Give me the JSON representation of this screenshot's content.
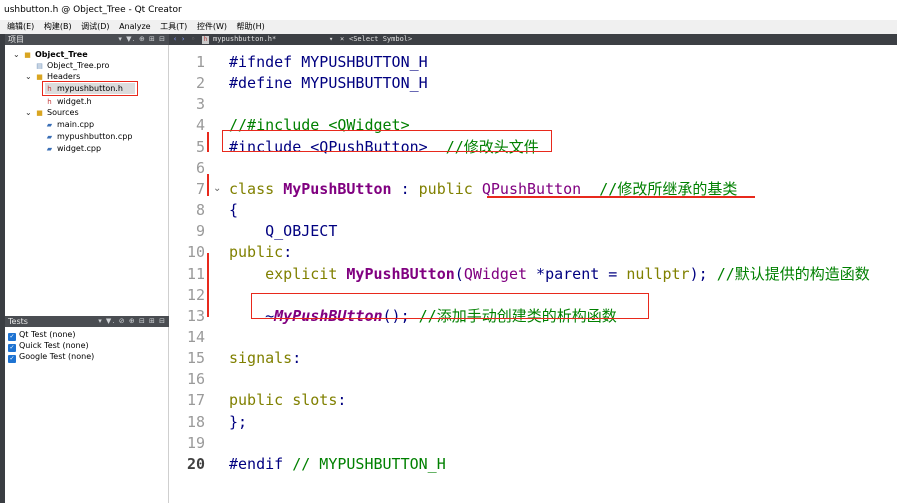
{
  "window": {
    "title": "ushbutton.h @ Object_Tree - Qt Creator"
  },
  "menu": [
    "编辑(E)",
    "构建(B)",
    "调试(D)",
    "Analyze",
    "工具(T)",
    "控件(W)",
    "帮助(H)"
  ],
  "projects_panel": {
    "title": "项目",
    "tools": "▾ ▼. ⊕ ⊞ ⊟",
    "tree": [
      {
        "label": "Object_Tree",
        "icon": "folder-icon",
        "bold": true
      },
      {
        "label": "Object_Tree.pro",
        "icon": "pro-file-icon"
      },
      {
        "label": "Headers",
        "icon": "folder-icon"
      },
      {
        "label": "mypushbutton.h",
        "icon": "header-file-icon",
        "selected": true
      },
      {
        "label": "widget.h",
        "icon": "header-file-icon"
      },
      {
        "label": "Sources",
        "icon": "folder-icon"
      },
      {
        "label": "main.cpp",
        "icon": "cpp-file-icon"
      },
      {
        "label": "mypushbutton.cpp",
        "icon": "cpp-file-icon"
      },
      {
        "label": "widget.cpp",
        "icon": "cpp-file-icon"
      }
    ]
  },
  "tests_panel": {
    "title": "Tests",
    "tools": "▾ ▼. ⊘ ⊕ ⊟ ⊞ ⊟",
    "items": [
      {
        "label": "Qt Test (none)",
        "checked": true
      },
      {
        "label": "Quick Test (none)",
        "checked": true
      },
      {
        "label": "Google Test (none)",
        "checked": true
      }
    ]
  },
  "editor_tabs": {
    "file": "mypushbutton.h*",
    "symbol": "<Select Symbol>",
    "close": "×"
  },
  "code": {
    "current_line": 20,
    "lines": [
      {
        "n": "1",
        "parts": [
          [
            "pp",
            "#ifndef MYPUSHBUTTON_H"
          ]
        ]
      },
      {
        "n": "2",
        "parts": [
          [
            "pp",
            "#define MYPUSHBUTTON_H"
          ]
        ]
      },
      {
        "n": "3",
        "parts": []
      },
      {
        "n": "4",
        "parts": [
          [
            "cm",
            "//#include <QWidget>"
          ]
        ]
      },
      {
        "n": "5",
        "parts": [
          [
            "pp",
            "#include <QPushButton>"
          ],
          [
            "cm",
            "  //修改头文件"
          ]
        ]
      },
      {
        "n": "6",
        "parts": []
      },
      {
        "n": "7",
        "parts": [
          [
            "kw",
            "class "
          ],
          [
            "cls",
            "MyPushBUtton"
          ],
          [
            "plain",
            " : "
          ],
          [
            "kw",
            "public "
          ],
          [
            "typ",
            "QPushButton"
          ],
          [
            "cm",
            "  //修改所继承的基类"
          ]
        ]
      },
      {
        "n": "8",
        "parts": [
          [
            "plain",
            "{"
          ]
        ]
      },
      {
        "n": "9",
        "parts": [
          [
            "mac",
            "    Q_OBJECT"
          ]
        ]
      },
      {
        "n": "10",
        "parts": [
          [
            "kw",
            "public"
          ],
          [
            "plain",
            ":"
          ]
        ]
      },
      {
        "n": "11",
        "parts": [
          [
            "kw",
            "    explicit "
          ],
          [
            "cls",
            "MyPushBUtton"
          ],
          [
            "plain",
            "("
          ],
          [
            "typ",
            "QWidget"
          ],
          [
            "plain",
            " *parent = "
          ],
          [
            "kw",
            "nullptr"
          ],
          [
            "plain",
            "); "
          ],
          [
            "cm",
            "//默认提供的构造函数"
          ]
        ]
      },
      {
        "n": "12",
        "parts": []
      },
      {
        "n": "13",
        "parts": [
          [
            "plain",
            "    ~"
          ],
          [
            "clsit",
            "MyPushBUtton"
          ],
          [
            "plain",
            "(); "
          ],
          [
            "cm",
            "//添加手动创建类的析构函数"
          ]
        ]
      },
      {
        "n": "14",
        "parts": []
      },
      {
        "n": "15",
        "parts": [
          [
            "kw",
            "signals"
          ],
          [
            "plain",
            ":"
          ]
        ]
      },
      {
        "n": "16",
        "parts": []
      },
      {
        "n": "17",
        "parts": [
          [
            "kw",
            "public "
          ],
          [
            "kw",
            "slots"
          ],
          [
            "plain",
            ":"
          ]
        ]
      },
      {
        "n": "18",
        "parts": [
          [
            "plain",
            "};"
          ]
        ]
      },
      {
        "n": "19",
        "parts": []
      },
      {
        "n": "20",
        "parts": [
          [
            "pp",
            "#endif"
          ],
          [
            "cm",
            " // MYPUSHBUTTON_H"
          ]
        ]
      }
    ]
  },
  "colors": {
    "annotation_red": "#e8291c",
    "keyword": "#808000",
    "comment": "#008000",
    "class_name": "#800080",
    "preprocessor": "#000080",
    "checkbox_blue": "#1e73d2"
  }
}
